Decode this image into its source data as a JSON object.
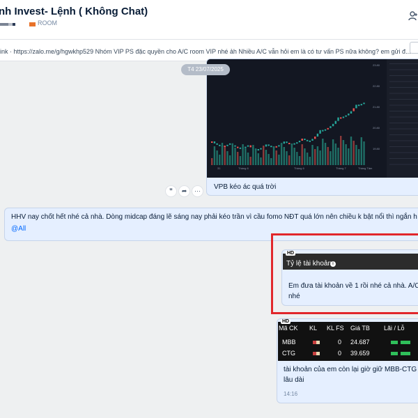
{
  "header": {
    "title": "nh Invest- Lệnh ( Không Chat)",
    "room_label": "ROOM"
  },
  "pinned": {
    "text": "link · https://zalo.me/g/hgwkhp529 Nhóm VIP PS đặc quyền cho A/C room VIP nhé ảh Nhiều A/C vẫn hỏi em là có tư vấn PS nữa không? em gửi đ..."
  },
  "date_chip": "T4 23/07/2025",
  "chart_message": {
    "caption": "VPB kéo ác quá trời"
  },
  "actions": {
    "quote": "❞",
    "share": "➦",
    "more": "···"
  },
  "message2": {
    "text": "HHV nay chốt hết nhé cả nhà. Dòng midcap đáng lẽ sáng nay phải kéo trần vì cầu fomo NĐT quá lớn nên chiều k bật nổi thì ngắn h",
    "mention": "@All"
  },
  "message3": {
    "hd": "HD",
    "card_title": "Tỷ lệ tài khoản",
    "text_line1": "Em đưa tài khoản về 1 rồi nhé cả nhà. A/C",
    "text_line2": "nhé"
  },
  "message4": {
    "hd": "HD",
    "columns": [
      "Mã CK",
      "KL",
      "KL FS",
      "Giá TB",
      "Lãi / Lỗ"
    ],
    "rows": [
      {
        "ticker": "MBB",
        "kl_fs": "0",
        "price": "24.687"
      },
      {
        "ticker": "CTG",
        "kl_fs": "0",
        "price": "39.659"
      }
    ],
    "text_line1": "tài khoản của em còn lại giờ giữ MBB-CTG c",
    "text_line2": "lâu dài",
    "time": "14:16"
  },
  "colors": {
    "accent": "#0068ff",
    "highlight": "#e1272b",
    "bubble": "#e5efff"
  }
}
